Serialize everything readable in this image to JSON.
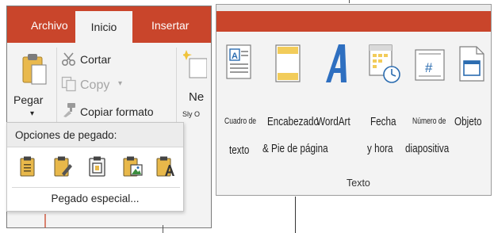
{
  "left_ribbon": {
    "tabs": {
      "archivo": "Archivo",
      "inicio": "Inicio",
      "insertar": "Insertar"
    },
    "paste_button": {
      "label": "Pegar",
      "arrow": "▾"
    },
    "clipboard": {
      "cut": "Cortar",
      "copy": "Copy",
      "copy_arrow": "▾",
      "format_painter": "Copiar formato"
    },
    "partial_button": {
      "label": "Ne",
      "sublabel": "Sly O"
    },
    "paste_menu": {
      "header": "Opciones de pegado:",
      "options": [
        {
          "icon": "paste-destination-theme-icon"
        },
        {
          "icon": "paste-keep-source-formatting-icon"
        },
        {
          "icon": "paste-embed-icon"
        },
        {
          "icon": "paste-picture-icon"
        },
        {
          "icon": "paste-keep-text-only-icon"
        }
      ],
      "special": "Pegado especial..."
    }
  },
  "right_ribbon": {
    "buttons": {
      "text_box": {
        "line1": "Cuadro de",
        "line2": "texto"
      },
      "header_footer": {
        "line1": "Encabezado",
        "line2": "& Pie de página"
      },
      "wordart": {
        "label": "WordArt"
      },
      "date_time": {
        "line1": "Fecha",
        "line2": "y hora"
      },
      "slide_number": {
        "line1": "Número de",
        "line2": "diapositiva"
      },
      "object": {
        "label": "Objeto"
      }
    },
    "group_label": "Texto"
  },
  "colors": {
    "accent": "#c9452b",
    "ribbon_bg": "#f3f3f3",
    "icon_blue": "#2b6cb0",
    "icon_gold": "#e8b84a"
  }
}
